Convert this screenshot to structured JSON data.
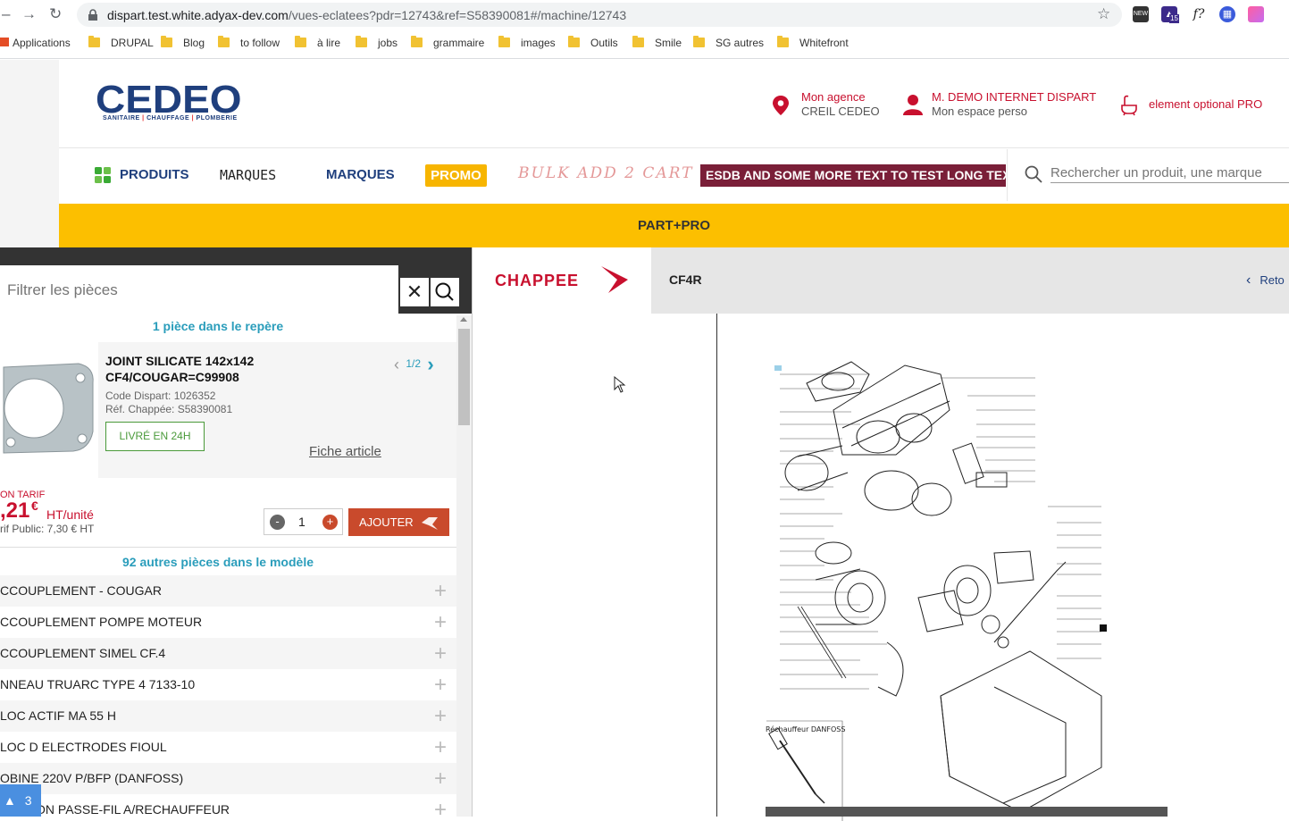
{
  "browser": {
    "url_host": "dispart.test.white.adyax-dev.com",
    "url_path": "/vues-eclatees?pdr=12743&ref=S58390081#/machine/12743",
    "bookmarks": [
      "Applications",
      "DRUPAL",
      "Blog",
      "to follow",
      "à lire",
      "jobs",
      "grammaire",
      "images",
      "Outils",
      "Smile",
      "SG autres",
      "Whitefront"
    ],
    "ext_badge": "15",
    "ext_new": "NEW"
  },
  "header": {
    "logo": "CEDEO",
    "logo_sub_1": "SANITAIRE",
    "logo_sub_2": "CHAUFFAGE",
    "logo_sub_3": "PLOMBERIE",
    "agency_label": "Mon agence",
    "agency_name": "CREIL CEDEO",
    "user_name": "M. DEMO INTERNET DISPART",
    "user_space": "Mon espace perso",
    "pro_label": "element optional PRO"
  },
  "nav": {
    "produits": "PRODUITS",
    "marques_1": "MARQUES",
    "marques_2": "MARQUES",
    "promo": "PROMO",
    "bulk": "BULK ADD 2 CART",
    "esdb": "ESDB AND SOME MORE TEXT TO TEST LONG TEXT",
    "search_placeholder": "Rechercher un produit, une marque"
  },
  "banner": "PART+PRO",
  "left": {
    "filter_placeholder": "Filtrer les pièces",
    "count_line": "1 pièce dans le repère",
    "product": {
      "name_line1": "JOINT SILICATE 142x142",
      "name_line2": "CF4/COUGAR=C99908",
      "code": "Code Dispart: 1026352",
      "ref": "Réf. Chappée: S58390081",
      "delivery": "LIVRÉ EN 24H",
      "fiche": "Fiche article",
      "pager": "1/2"
    },
    "price": {
      "tarif_label": "ON TARIF",
      "amount": ",21",
      "currency": "€",
      "unit": "HT/unité",
      "public": "rif Public: 7,30 € HT",
      "qty": "1",
      "add": "AJOUTER"
    },
    "other_count": "92 autres pièces dans le modèle",
    "parts": [
      "CCOUPLEMENT - COUGAR",
      "CCOUPLEMENT POMPE MOTEUR",
      "CCOUPLEMENT SIMEL CF.4",
      "NNEAU TRUARC TYPE 4 7133-10",
      "LOC ACTIF MA 55 H",
      "LOC D ELECTRODES FIOUL",
      "OBINE 220V P/BFP (DANFOSS)",
      "ON PASSE-FIL A/RECHAUFFEUR"
    ],
    "badge": "3"
  },
  "right": {
    "brand": "CHAPPEE",
    "model": "CF4R",
    "retour": "Reto",
    "rechauffeur": "Réchauffeur DANFOSS"
  },
  "colors": {
    "cedeo_blue": "#1f3f7d",
    "cedeo_red": "#c8102e",
    "banner_yellow": "#fcbf00",
    "teal": "#2a9dbb",
    "add_button": "#c94a2c"
  }
}
